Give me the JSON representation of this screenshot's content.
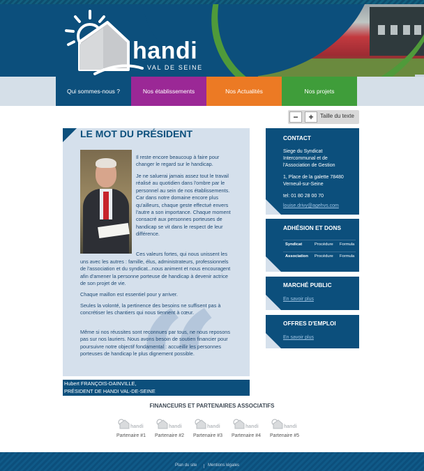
{
  "header": {
    "logo_main": "handi",
    "logo_sub": "VAL DE SEINE"
  },
  "nav": {
    "items": [
      {
        "label": "Qui sommes-nous ?",
        "color": "#0c4f7c"
      },
      {
        "label": "Nos établissements",
        "color": "#9b2896"
      },
      {
        "label": "Nos Actualités",
        "color": "#ec7a24"
      },
      {
        "label": "Nos projets",
        "color": "#3f9d3a"
      }
    ]
  },
  "text_size": {
    "minus": "−",
    "plus": "+",
    "label": "Taille du texte"
  },
  "article": {
    "title": "LE MOT DU PRÉSIDENT",
    "p1": "Il reste encore beaucoup à faire pour changer le regard sur le handicap.",
    "p2": "Je ne saluerai jamais assez tout le travail réalisé au quotidien dans l'ombre par le personnel au sein de nos établissements. Car dans notre domaine encore plus qu'ailleurs, chaque geste effectué envers l'autre a son importance. Chaque moment consacré aux personnes porteuses de handicap se vit dans le respect de leur différence.",
    "p3a": "Ces valeurs fortes, qui nous unissent les",
    "p3b": "uns avec les autres : famille, élus, administrateurs, professionnels de l'association et du syndicat...nous animent et nous encouragent afin d'amener la personne porteuse de handicap à devenir actrice de son projet de vie.",
    "p4": "Chaque maillon est essentiel pour y arriver.",
    "p5": "Seules la volonté, la pertinence des besoins ne suffisent pas à concrétiser les chantiers qui nous tiennent à cœur.",
    "p6": "Même si nos réussites sont reconnues par tous, ne nous reposons pas sur nos lauriers. Nous avons besoin de soutien financier pour poursuivre notre objectif fondamental : accueillir les personnes porteuses de handicap le plus dignement possible.",
    "signature_name": "Hubert FRANÇOIS-DAINVILLE,",
    "signature_role": "PRÉSIDENT DE HANDI VAL-DE-SEINE"
  },
  "sidebar": {
    "contact": {
      "title": "CONTACT",
      "org_line1": "Siege du Syndicat",
      "org_line2": "Intercommunal et de",
      "org_line3": "l'Association de Gestion",
      "addr_line1": "1, Place de la galette 78480",
      "addr_line2": "Verneuil-sur-Seine",
      "phone": "tel: 01 80 28 00 70",
      "email": "louise.drivy@agehvs.com"
    },
    "adhesion": {
      "title": "ADHÉSION ET DONS",
      "rows": [
        {
          "name": "Syndicat",
          "col1": "Procédure",
          "col2": "Formula"
        },
        {
          "name": "Association",
          "col1": "Procédure",
          "col2": "Formula"
        }
      ]
    },
    "marche": {
      "title": "MARCHÉ PUBLIC",
      "link": "En savoir plus"
    },
    "offres": {
      "title": "OFFRES D'EMPLOI",
      "link": "En savoir plus"
    }
  },
  "partners": {
    "title": "FINANCEURS ET PARTENAIRES ASSOCIATIFS",
    "logo_text": "handi",
    "items": [
      "Partenaire #1",
      "Partenaire #2",
      "Partenaire #3",
      "Partenaire #4",
      "Partenaire #5"
    ]
  },
  "footer": {
    "sitemap": "Plan du site",
    "legal": "Mentions légales"
  }
}
